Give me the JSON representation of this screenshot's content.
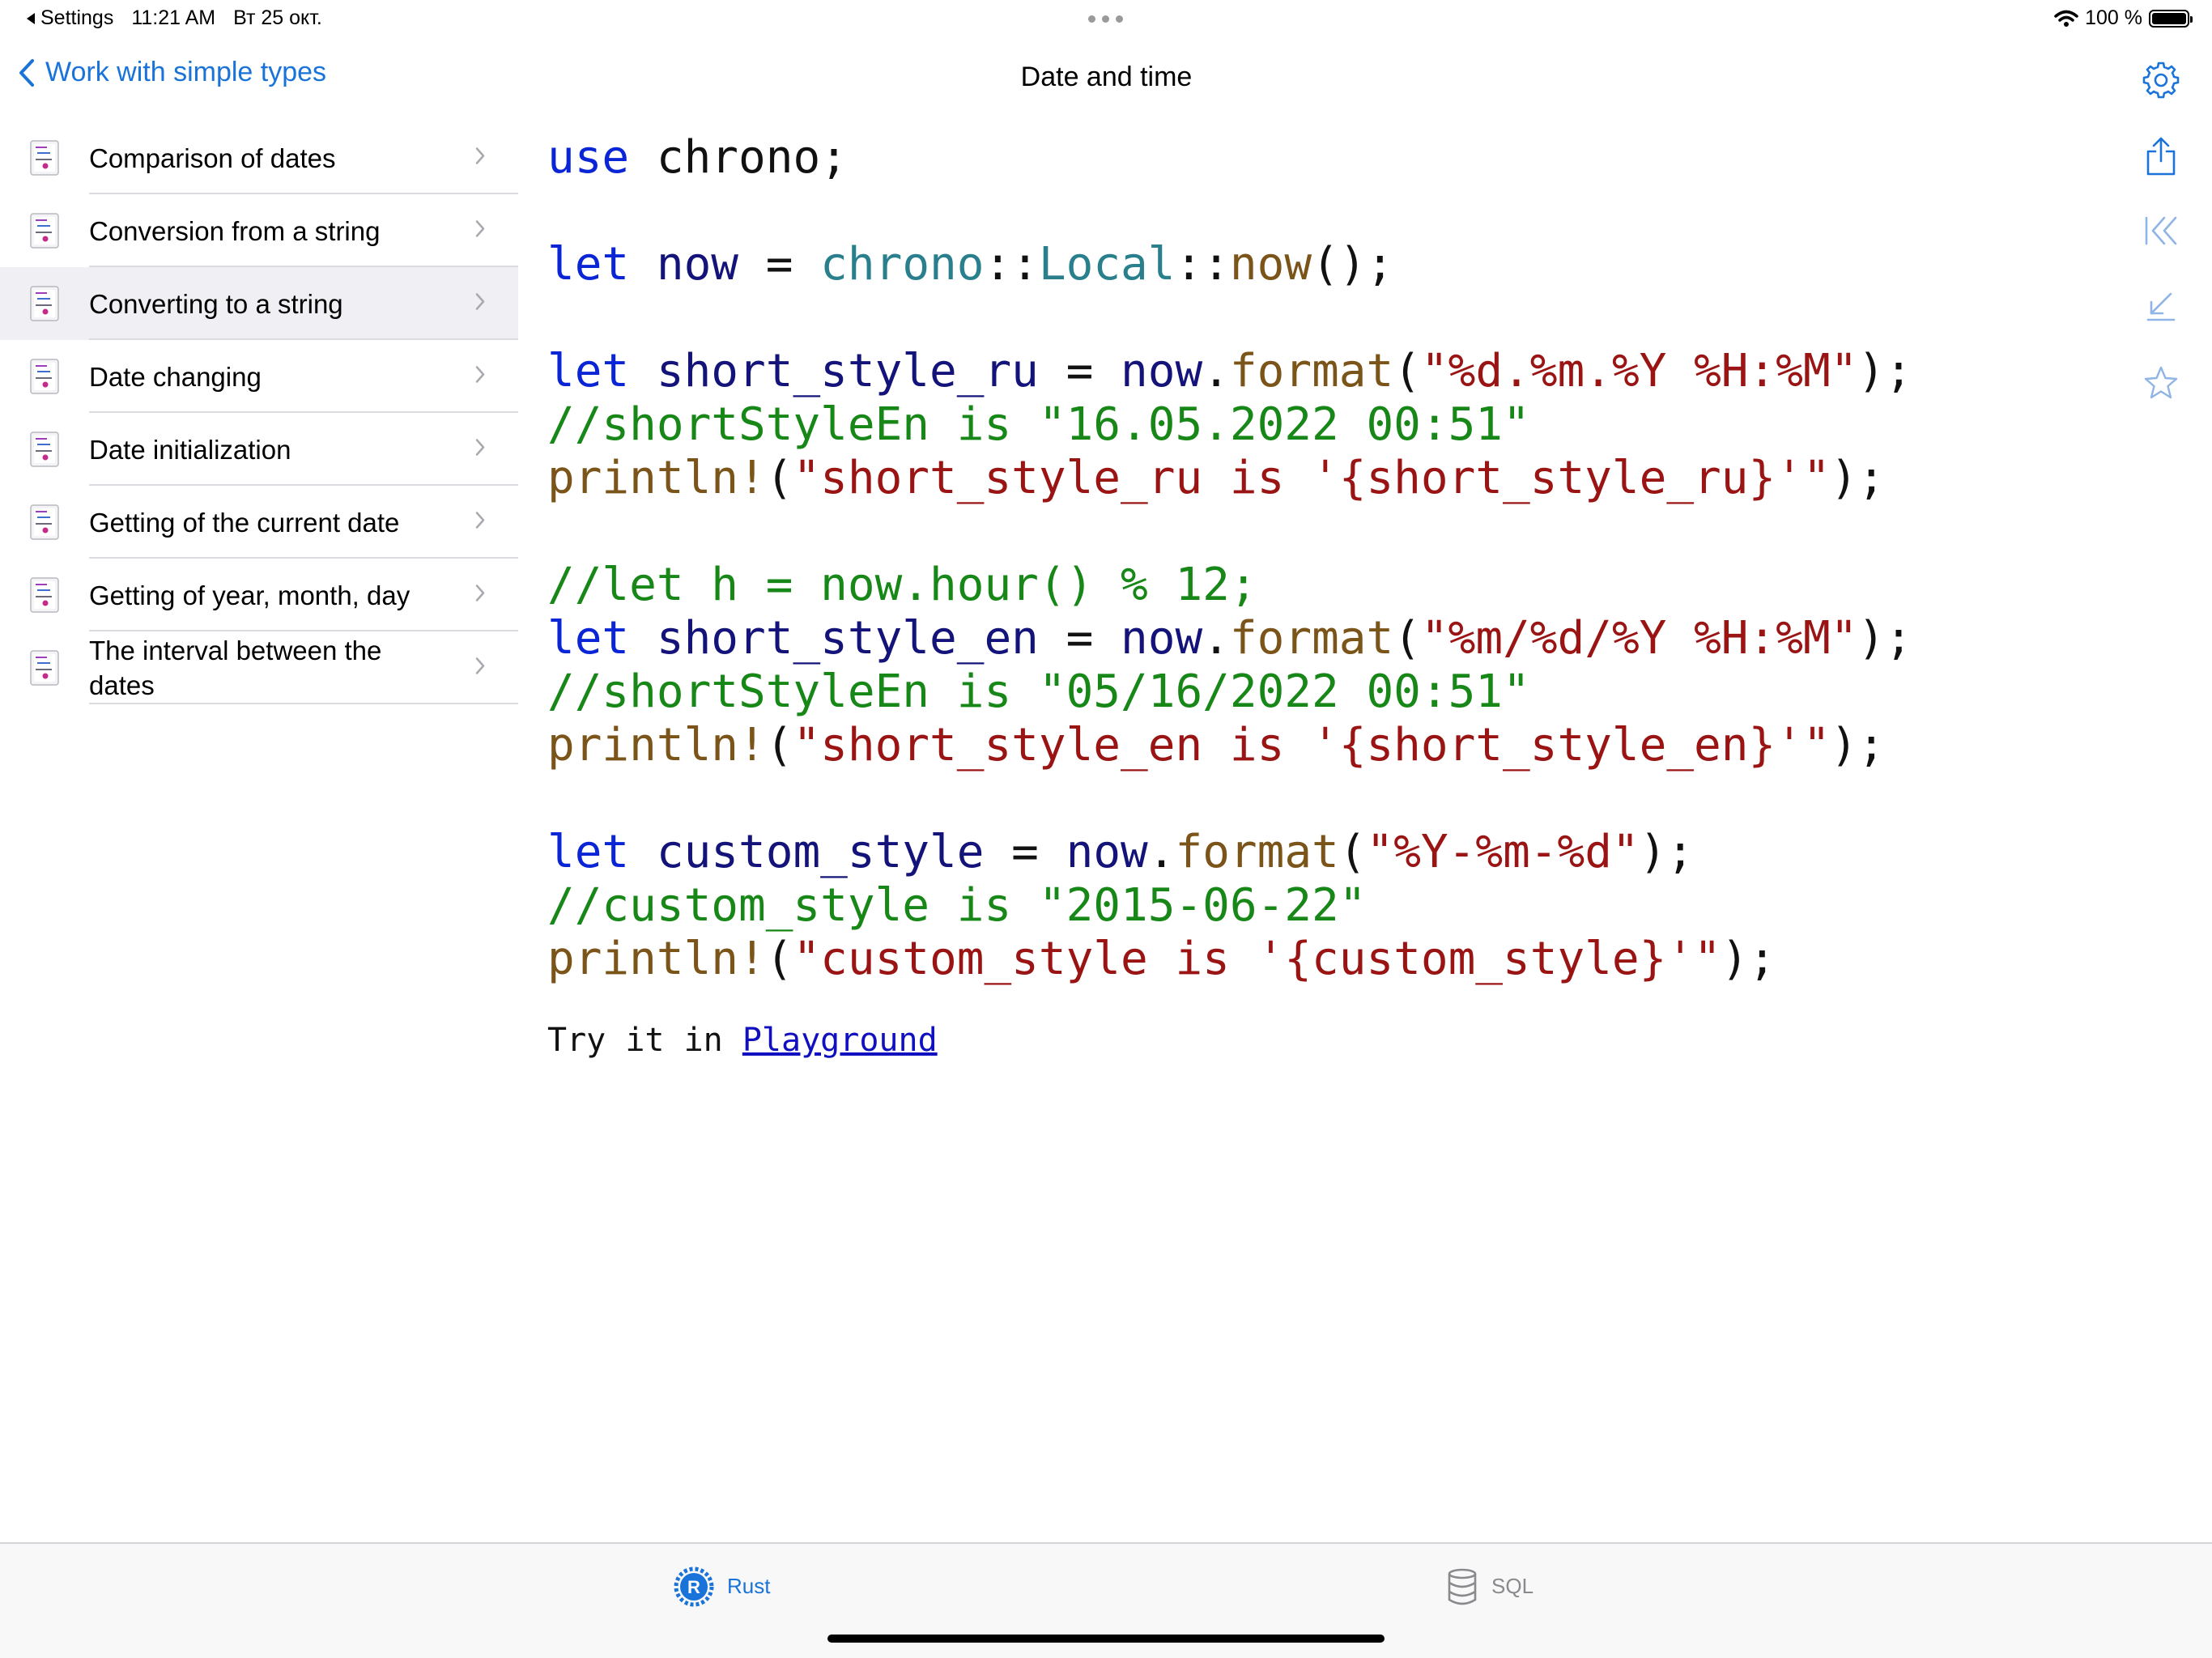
{
  "status_bar": {
    "back_app": "Settings",
    "time": "11:21 AM",
    "date": "Вт 25 окт.",
    "battery": "100 %"
  },
  "nav": {
    "back_label": "Work with simple types",
    "title": "Date and time"
  },
  "toolbar_icons": [
    "gear-icon",
    "share-icon",
    "jump-to-start-icon",
    "collapse-icon",
    "star-icon"
  ],
  "sidebar": {
    "items": [
      {
        "label": "Comparison of dates",
        "selected": false
      },
      {
        "label": "Conversion from a string",
        "selected": false
      },
      {
        "label": "Converting to a string",
        "selected": true
      },
      {
        "label": "Date changing",
        "selected": false
      },
      {
        "label": "Date initialization",
        "selected": false
      },
      {
        "label": "Getting of the current date",
        "selected": false
      },
      {
        "label": "Getting of year, month, day",
        "selected": false
      },
      {
        "label": "The interval between the dates",
        "selected": false
      }
    ]
  },
  "code": {
    "lines": [
      [
        {
          "t": "use",
          "c": "kw"
        },
        {
          "t": " chrono;",
          "c": "pl"
        }
      ],
      [],
      [
        {
          "t": "let",
          "c": "kw"
        },
        {
          "t": " now",
          "c": "id"
        },
        {
          "t": " = ",
          "c": "pl"
        },
        {
          "t": "chrono",
          "c": "ty"
        },
        {
          "t": "::",
          "c": "pl"
        },
        {
          "t": "Local",
          "c": "ty"
        },
        {
          "t": "::",
          "c": "pl"
        },
        {
          "t": "now",
          "c": "fn"
        },
        {
          "t": "();",
          "c": "pl"
        }
      ],
      [],
      [
        {
          "t": "let",
          "c": "kw"
        },
        {
          "t": " short_style_ru",
          "c": "id"
        },
        {
          "t": " = ",
          "c": "pl"
        },
        {
          "t": "now",
          "c": "id"
        },
        {
          "t": ".",
          "c": "pl"
        },
        {
          "t": "format",
          "c": "fn"
        },
        {
          "t": "(",
          "c": "pl"
        },
        {
          "t": "\"%d.%m.%Y %H:%M\"",
          "c": "str"
        },
        {
          "t": ");",
          "c": "pl"
        }
      ],
      [
        {
          "t": "//shortStyleEn is \"16.05.2022 00:51\"",
          "c": "cm"
        }
      ],
      [
        {
          "t": "println!",
          "c": "fn"
        },
        {
          "t": "(",
          "c": "pl"
        },
        {
          "t": "\"short_style_ru is '{short_style_ru}'\"",
          "c": "str"
        },
        {
          "t": ");",
          "c": "pl"
        }
      ],
      [],
      [
        {
          "t": "//let h = now.hour() % 12;",
          "c": "cm"
        }
      ],
      [
        {
          "t": "let",
          "c": "kw"
        },
        {
          "t": " short_style_en",
          "c": "id"
        },
        {
          "t": " = ",
          "c": "pl"
        },
        {
          "t": "now",
          "c": "id"
        },
        {
          "t": ".",
          "c": "pl"
        },
        {
          "t": "format",
          "c": "fn"
        },
        {
          "t": "(",
          "c": "pl"
        },
        {
          "t": "\"%m/%d/%Y %H:%M\"",
          "c": "str"
        },
        {
          "t": ");",
          "c": "pl"
        }
      ],
      [
        {
          "t": "//shortStyleEn is \"05/16/2022 00:51\"",
          "c": "cm"
        }
      ],
      [
        {
          "t": "println!",
          "c": "fn"
        },
        {
          "t": "(",
          "c": "pl"
        },
        {
          "t": "\"short_style_en is '{short_style_en}'\"",
          "c": "str"
        },
        {
          "t": ");",
          "c": "pl"
        }
      ],
      [],
      [
        {
          "t": "let",
          "c": "kw"
        },
        {
          "t": " custom_style",
          "c": "id"
        },
        {
          "t": " = ",
          "c": "pl"
        },
        {
          "t": "now",
          "c": "id"
        },
        {
          "t": ".",
          "c": "pl"
        },
        {
          "t": "format",
          "c": "fn"
        },
        {
          "t": "(",
          "c": "pl"
        },
        {
          "t": "\"%Y-%m-%d\"",
          "c": "str"
        },
        {
          "t": ");",
          "c": "pl"
        }
      ],
      [
        {
          "t": "//custom_style is \"2015-06-22\"",
          "c": "cm"
        }
      ],
      [
        {
          "t": "println!",
          "c": "fn"
        },
        {
          "t": "(",
          "c": "pl"
        },
        {
          "t": "\"custom_style is '{custom_style}'\"",
          "c": "str"
        },
        {
          "t": ");",
          "c": "pl"
        }
      ]
    ]
  },
  "footer_link": {
    "prefix": "Try it in ",
    "link": "Playground"
  },
  "tabs": [
    {
      "label": "Rust",
      "icon": "rust-icon",
      "active": true
    },
    {
      "label": "SQL",
      "icon": "database-icon",
      "active": false
    }
  ],
  "colors": {
    "accent": "#1a73d9",
    "selected_row": "#efeff4",
    "keyword": "#0a25d6",
    "identifier": "#13137a",
    "type": "#2a7f8c",
    "function": "#7a5419",
    "string": "#9a1414",
    "comment": "#178717"
  }
}
